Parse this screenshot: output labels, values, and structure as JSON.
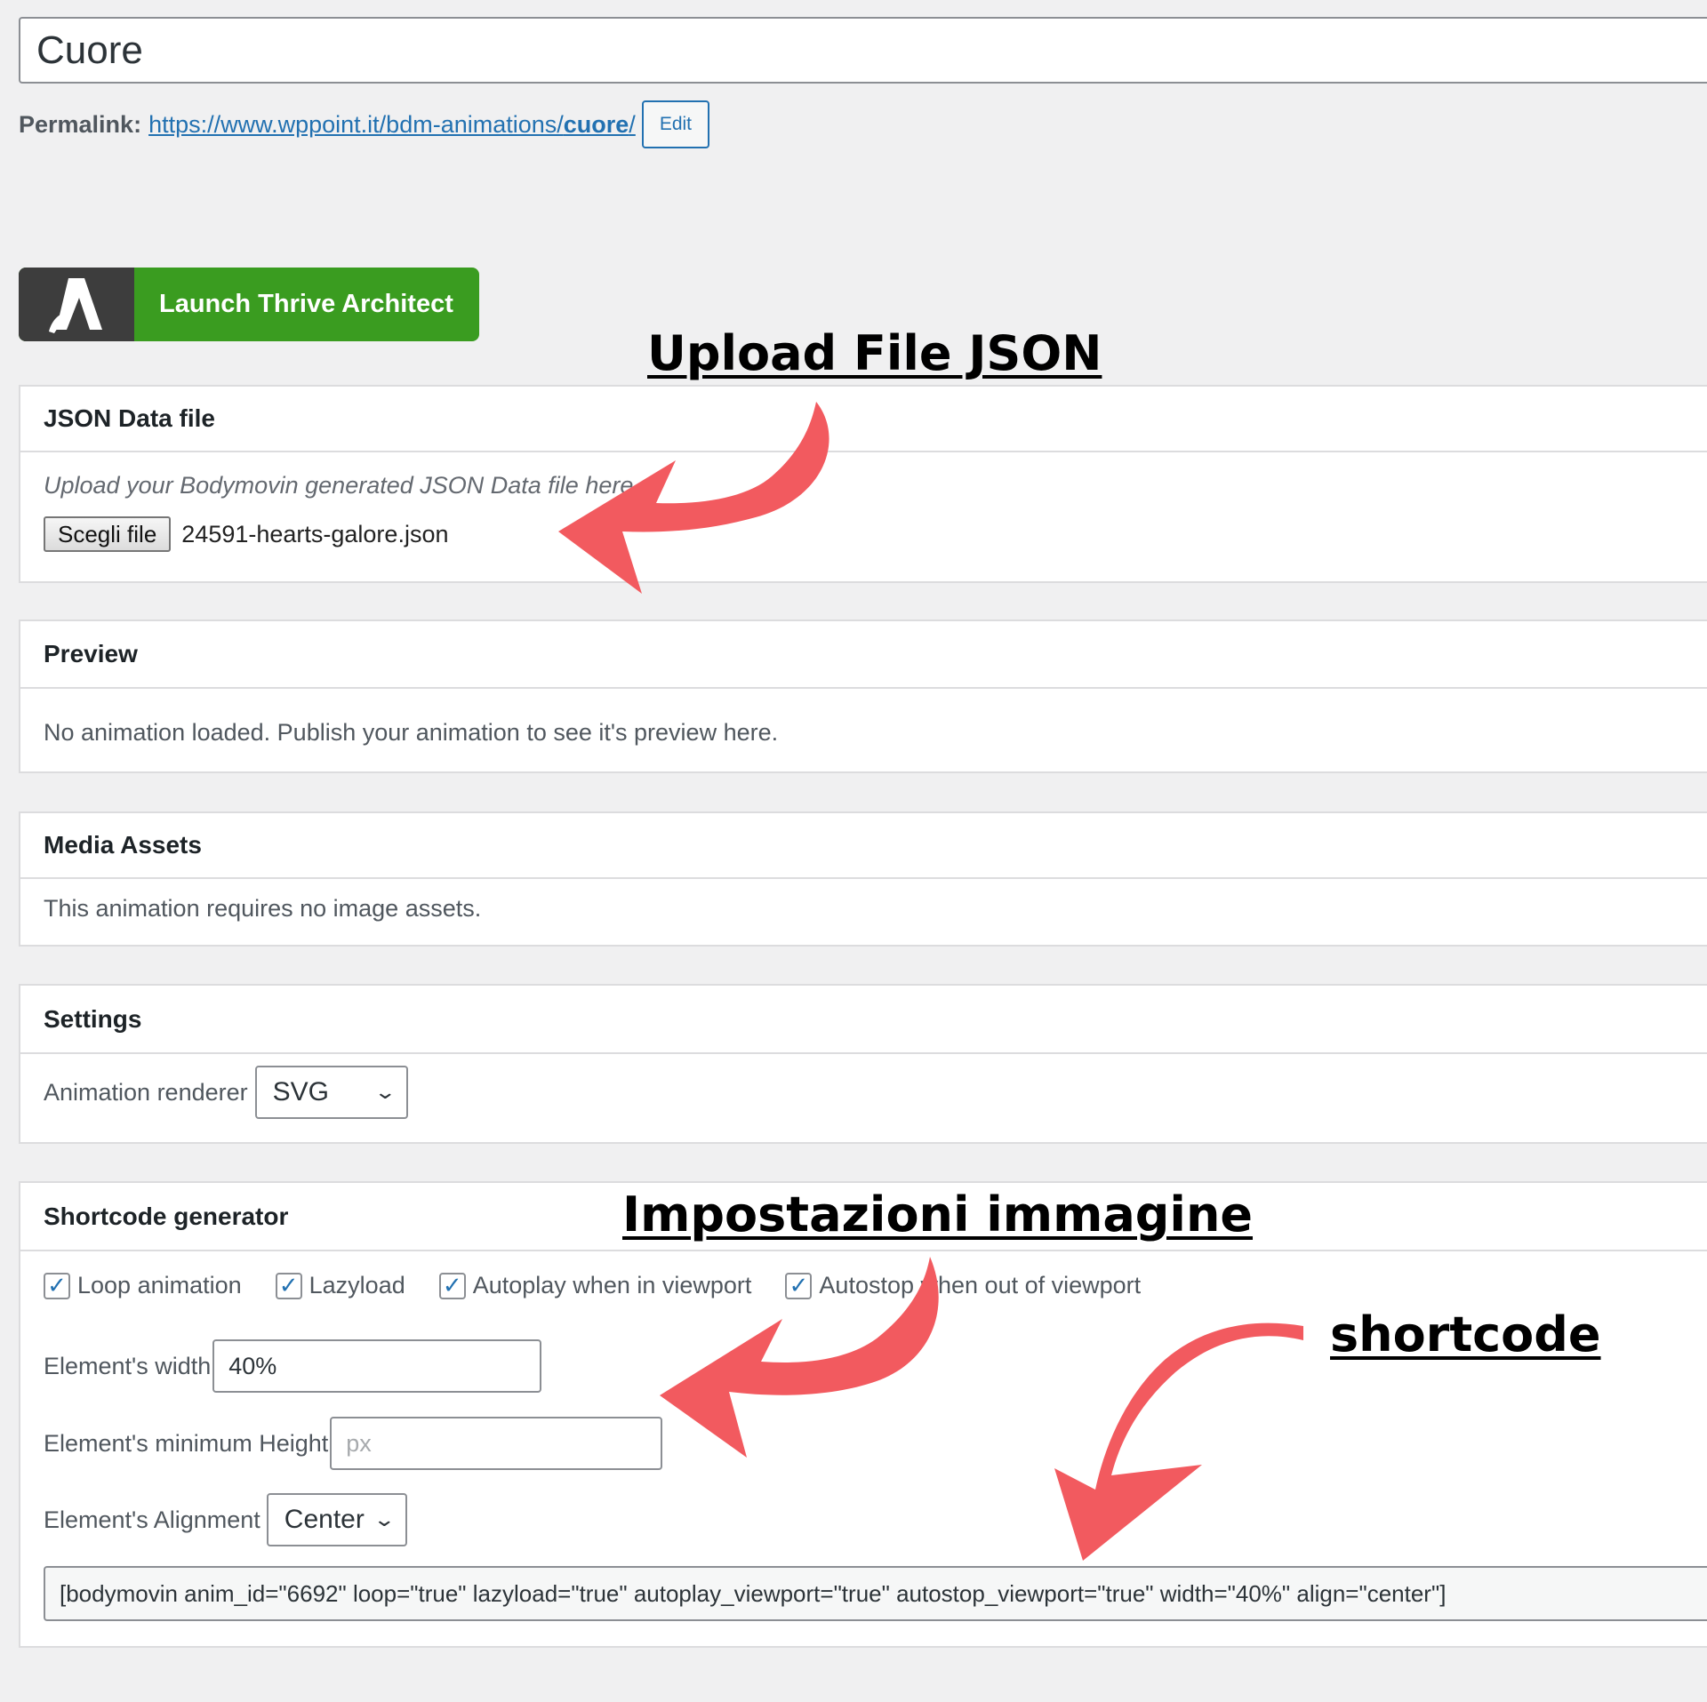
{
  "post": {
    "title": "Cuore",
    "permalink_label": "Permalink:",
    "permalink_url_prefix": "https://www.wppoint.it/bdm-animations/",
    "permalink_slug": "cuore",
    "permalink_url_suffix": "/",
    "edit_label": "Edit"
  },
  "launch": {
    "label": "Launch Thrive Architect",
    "logo_icon": "thrive-architect-logo-icon"
  },
  "json_panel": {
    "title": "JSON Data file",
    "instructions": "Upload your Bodymovin generated JSON Data file here.",
    "choose_label": "Scegli file",
    "file_name": "24591-hearts-galore.json"
  },
  "preview_panel": {
    "title": "Preview",
    "text": "No animation loaded. Publish your animation to see it's preview here."
  },
  "media_panel": {
    "title": "Media Assets",
    "text": "This animation requires no image assets."
  },
  "settings_panel": {
    "title": "Settings",
    "renderer_label": "Animation renderer",
    "renderer_value": "SVG"
  },
  "shortcode_panel": {
    "title": "Shortcode generator",
    "checkboxes": [
      {
        "label": "Loop animation",
        "checked": true
      },
      {
        "label": "Lazyload",
        "checked": true
      },
      {
        "label": "Autoplay when in viewport",
        "checked": true
      },
      {
        "label": "Autostop when out of viewport",
        "checked": true
      }
    ],
    "width_label": "Element's width",
    "width_value": "40%",
    "min_height_label": "Element's minimum Height",
    "min_height_placeholder": "px",
    "alignment_label": "Element's Alignment",
    "alignment_value": "Center",
    "shortcode": "[bodymovin anim_id=\"6692\" loop=\"true\" lazyload=\"true\" autoplay_viewport=\"true\" autostop_viewport=\"true\" width=\"40%\" align=\"center\"]"
  },
  "annotations": {
    "upload": "Upload File JSON",
    "image_settings": "Impostazioni immagine",
    "shortcode": "shortcode",
    "arrow_color": "#f25a5f"
  },
  "colors": {
    "page_bg": "#f0f0f1",
    "link": "#2271b1",
    "launch_green": "#3a9c20",
    "launch_dark": "#3d3d3d"
  }
}
